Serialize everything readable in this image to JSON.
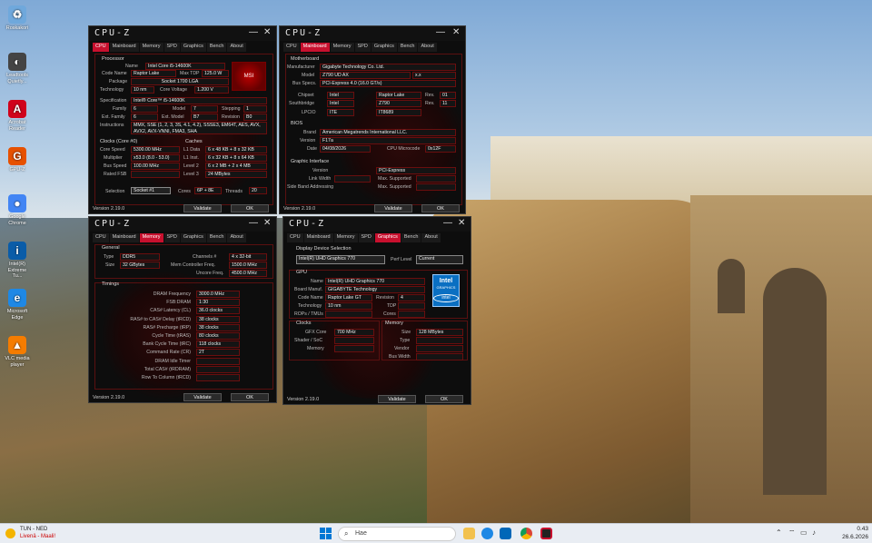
{
  "desktop": {
    "icons": [
      {
        "label": "Roskakori",
        "color": "#6fa8dc",
        "glyph": "♻"
      },
      {
        "label": "Leadtools Quietly...",
        "color": "#444",
        "glyph": "◐"
      },
      {
        "label": "Acrobat Reader",
        "color": "#d0021b",
        "glyph": "A"
      },
      {
        "label": "GPU-Z",
        "color": "#e65100",
        "glyph": "G"
      },
      {
        "label": "Google Chrome",
        "color": "#4285f4",
        "glyph": "●"
      },
      {
        "label": "Intel(R) Extreme Tu...",
        "color": "#0a5ca8",
        "glyph": "i"
      },
      {
        "label": "Microsoft Edge",
        "color": "#1e88e5",
        "glyph": "e"
      },
      {
        "label": "VLC media player",
        "color": "#f57c00",
        "glyph": "▲"
      }
    ]
  },
  "common": {
    "title": "CPU-Z",
    "min": "—",
    "close": "✕",
    "version": "Version 2.19.0",
    "validate": "Validate",
    "ok": "OK",
    "tabs": [
      "CPU",
      "Mainboard",
      "Memory",
      "SPD",
      "Graphics",
      "Bench",
      "About"
    ]
  },
  "cpu": {
    "processor_group": "Processor",
    "name_l": "Name",
    "name": "Intel Core i5-14600K",
    "codename_l": "Code Name",
    "codename": "Raptor Lake",
    "maxtdp_l": "Max TDP",
    "maxtdp": "125.0 W",
    "package_l": "Package",
    "package": "Socket 1700 LGA",
    "tech_l": "Technology",
    "tech": "10 nm",
    "cv_l": "Core Voltage",
    "cv": "1.200 V",
    "spec_l": "Specification",
    "spec": "Intel® Core™ i5-14600K",
    "family_l": "Family",
    "family": "6",
    "model_l": "Model",
    "model": "7",
    "stepping_l": "Stepping",
    "stepping": "1",
    "extfam_l": "Ext. Family",
    "extfam": "6",
    "extmodel_l": "Ext. Model",
    "extmodel": "B7",
    "rev_l": "Revision",
    "rev": "B0",
    "instr_l": "Instructions",
    "instr": "MMX, SSE (1, 2, 3, 3S, 4.1, 4.2), SSSE3, EM64T, AES, AVX, AVX2, AVX-VNNI, FMA3, SHA",
    "clocks_group": "Clocks (Core #0)",
    "cache_group": "Caches",
    "corespeed_l": "Core Speed",
    "corespeed": "5300.00 MHz",
    "mult_l": "Multiplier",
    "mult": "x53.0 (8.0 - 53.0)",
    "bus_l": "Bus Speed",
    "bus": "100.00 MHz",
    "fsb_l": "Rated FSB",
    "fsb": "",
    "l1d_l": "L1 Data",
    "l1d": "6 x 48 KB + 8 x 32 KB",
    "l1i_l": "L1 Inst.",
    "l1i": "6 x 32 KB + 8 x 64 KB",
    "l2_l": "Level 2",
    "l2": "6 x 2 MB + 2 x 4 MB",
    "l3_l": "Level 3",
    "l3": "24 MBytes",
    "sel_l": "Selection",
    "sel": "Socket #1",
    "cores_l": "Cores",
    "cores": "6P + 8E",
    "threads_l": "Threads",
    "threads": "20"
  },
  "mainboard": {
    "group": "Motherboard",
    "manu_l": "Manufacturer",
    "manu": "Gigabyte Technology Co. Ltd.",
    "model_l": "Model",
    "model": "Z790 UD AX",
    "model2": "x.x",
    "busspecs_l": "Bus Specs.",
    "busspecs": "PCI-Express 4.0 (16.0 GT/s)",
    "chipset_l": "Chipset",
    "chipset_v": "Intel",
    "chipset_n": "Raptor Lake",
    "rev_l": "Rev.",
    "chipset_rev": "01",
    "sb_l": "Southbridge",
    "sb_v": "Intel",
    "sb_n": "Z790",
    "sb_rev": "11",
    "lpcio_l": "LPCIO",
    "lpcio_v": "ITE",
    "lpcio_n": "IT8689",
    "bios_group": "BIOS",
    "brand_l": "Brand",
    "brand": "American Megatrends International LLC.",
    "ver_l": "Version",
    "ver": "F17a",
    "date_l": "Date",
    "date": "04/08/2026",
    "ucode_l": "CPU Microcode",
    "ucode": "0x12F",
    "gi_group": "Graphic Interface",
    "giver_l": "Version",
    "giver": "PCI-Express",
    "gilink_l": "Link Width",
    "gimax_l": "Max. Supported",
    "gilink": "",
    "gimax": "",
    "gisb_l": "Side Band Addressing",
    "gimax2": ""
  },
  "memory": {
    "group": "General",
    "type_l": "Type",
    "type": "DDR5",
    "ch_l": "Channels #",
    "ch": "4 x 32-bit",
    "size_l": "Size",
    "size": "32 GBytes",
    "mcf_l": "Mem Controller Freq.",
    "mcf": "1500.0 MHz",
    "uncore_l": "Uncore Freq.",
    "uncore": "4500.0 MHz",
    "timings_group": "Timings",
    "rows": [
      {
        "l": "DRAM Frequency",
        "v": "3000.0 MHz"
      },
      {
        "l": "FSB:DRAM",
        "v": "1:30"
      },
      {
        "l": "CAS# Latency (CL)",
        "v": "36.0 clocks"
      },
      {
        "l": "RAS# to CAS# Delay (tRCD)",
        "v": "38 clocks"
      },
      {
        "l": "RAS# Precharge (tRP)",
        "v": "38 clocks"
      },
      {
        "l": "Cycle Time (tRAS)",
        "v": "80 clocks"
      },
      {
        "l": "Bank Cycle Time (tRC)",
        "v": "118 clocks"
      },
      {
        "l": "Command Rate (CR)",
        "v": "2T"
      },
      {
        "l": "DRAM Idle Timer",
        "v": ""
      },
      {
        "l": "Total CAS# (tRDRAM)",
        "v": ""
      },
      {
        "l": "Row To Column (tRCD)",
        "v": ""
      }
    ]
  },
  "graphics": {
    "group": "Display Device Selection",
    "device": "Intel(R) UHD Graphics 770",
    "perf_l": "Perf Level",
    "perf": "Current",
    "gpu_group": "GPU",
    "name_l": "Name",
    "name": "Intel(R) UHD Graphics 770",
    "board_l": "Board Manuf.",
    "board": "GIGABYTE Technology",
    "code_l": "Code Name",
    "code": "Raptor Lake GT",
    "rev_l": "Revision",
    "rev": "4",
    "tech_l": "Technology",
    "tech": "10 nm",
    "tdp_l": "TDP",
    "tdp": "",
    "rops_l": "ROPs / TMUs",
    "rops": "",
    "cores_l": "Cores",
    "cores": "",
    "clocks_group": "Clocks",
    "gfx_l": "GFX Core",
    "gfx": "700 MHz",
    "shader_l": "Shader / SoC",
    "shader": "",
    "memc_l": "Memory",
    "memc": "",
    "mem_group": "Memory",
    "msize_l": "Size",
    "msize": "128 MBytes",
    "mtype_l": "Type",
    "mtype": "",
    "vendor_l": "Vendor",
    "vendor": "",
    "bw_l": "Bus Width",
    "bw": "",
    "intel1": "Intel",
    "intel2": "GRAPHICS",
    "intel3": "intel"
  },
  "taskbar": {
    "weather_title": "TUN - NED",
    "weather_sub": "Livenä - Maali!",
    "search_ph": "Hae",
    "time": "0.43",
    "date": "26.6.2026"
  }
}
